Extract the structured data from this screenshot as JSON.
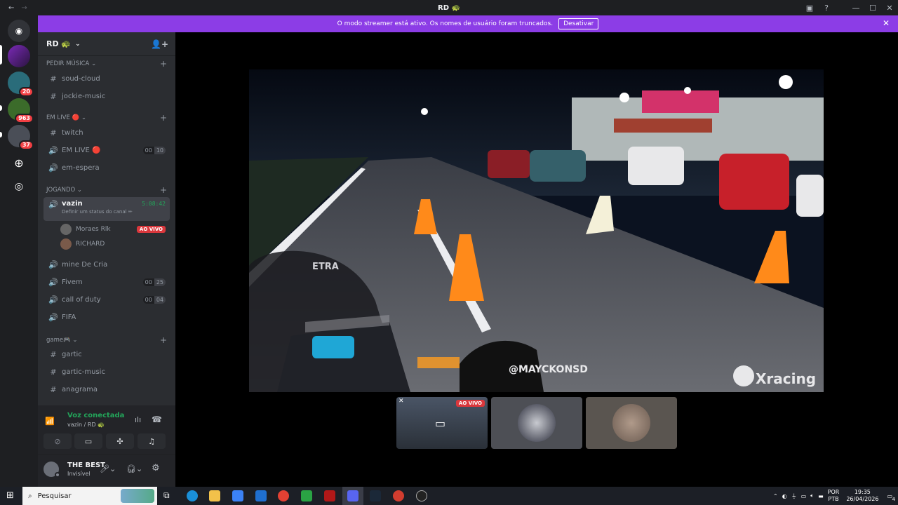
{
  "titlebar": {
    "title": "RD 🐢"
  },
  "banner": {
    "text": "O modo streamer está ativo. Os nomes de usuário foram truncados.",
    "button": "Desativar"
  },
  "servers": [
    {
      "badge": ""
    },
    {
      "badge": "20"
    },
    {
      "badge": "963"
    },
    {
      "badge": "37"
    }
  ],
  "server": {
    "name": "RD 🐢"
  },
  "categories": [
    {
      "label": "PEDIR MÚSICA ⌄"
    },
    {
      "label": "EM LIVE 🔴 ⌄"
    },
    {
      "label": "JOGANDO ⌄"
    },
    {
      "label": "game🎮 ⌄"
    }
  ],
  "channels": {
    "soud": "soud-cloud",
    "jockie": "jockie-music",
    "twitch": "twitch",
    "emlive": "EM LIVE 🔴",
    "emlive_a": "00",
    "emlive_b": "10",
    "espera": "em-espera",
    "vazin": "vazin",
    "vazin_status": "Definir um status do canal ✏",
    "vazin_time": "5:08:42",
    "mine": "mine De Cria",
    "fivem": "Fivem",
    "fivem_a": "00",
    "fivem_b": "25",
    "cod": "call of duty",
    "cod_a": "00",
    "cod_b": "04",
    "fifa": "FIFA",
    "gartic": "gartic",
    "garticm": "gartic-music",
    "anagrama": "anagrama"
  },
  "voice_users": [
    {
      "name": "Moraes Rlk",
      "live": "AO VIVO"
    },
    {
      "name": "RICHARD",
      "live": ""
    }
  ],
  "voice": {
    "status": "Voz conectada",
    "where": "vazin / RD 🐢"
  },
  "me": {
    "name": "THE BEST",
    "status": "Invisível"
  },
  "video": {
    "watermark1": "@MAYCKONSD",
    "watermark2": "Xracing",
    "sign": "ETRA"
  },
  "thumbs": {
    "live": "AO VIVO"
  },
  "taskbar": {
    "search": "Pesquisar",
    "lang1": "POR",
    "lang2": "PTB",
    "time": "19:35",
    "date": "26/04/2026",
    "notif": "4"
  },
  "colors": {
    "accent": "#8c3de6",
    "voice_green": "#23a55a",
    "live_red": "#da373c"
  }
}
